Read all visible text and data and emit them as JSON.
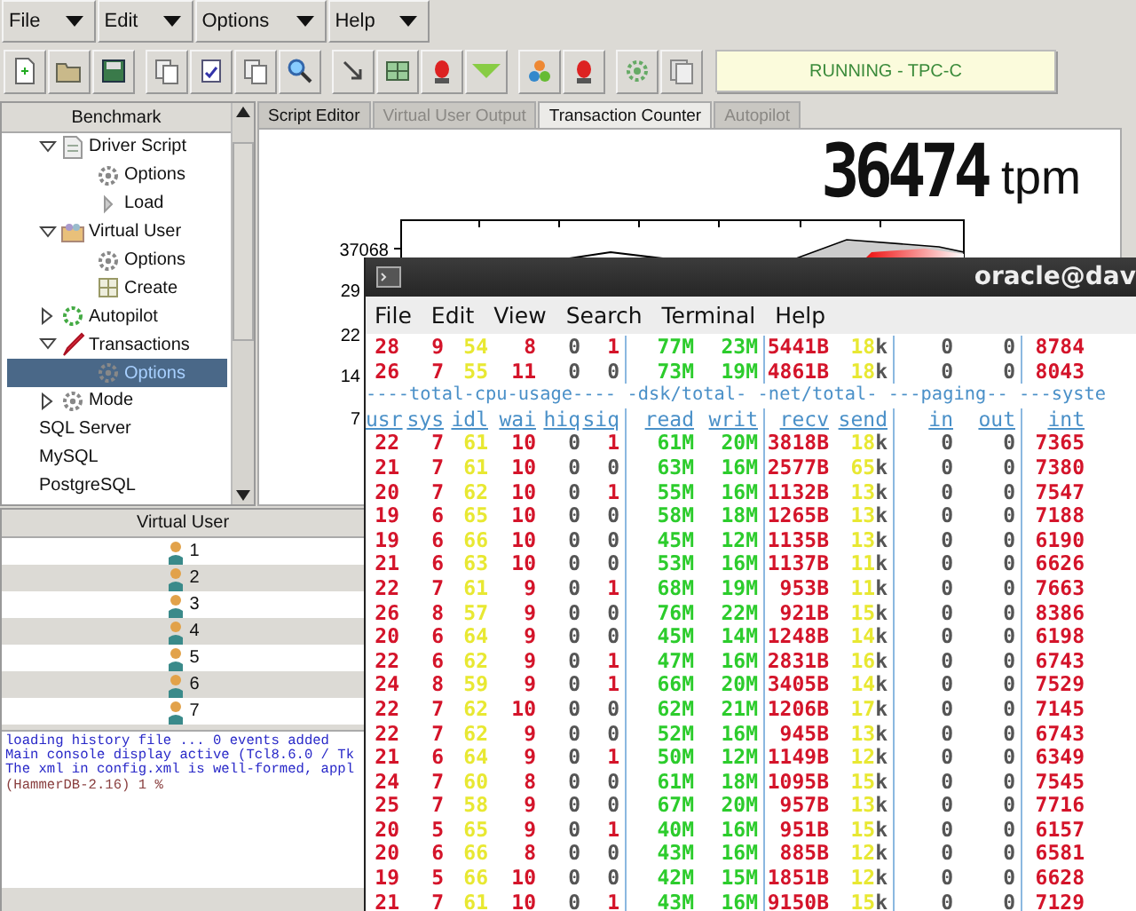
{
  "menus": [
    "File",
    "Edit",
    "Options",
    "Help"
  ],
  "status": "RUNNING - TPC-C",
  "tree": {
    "header": "Benchmark",
    "items": [
      {
        "children": [
          {
            "label": "Driver Script",
            "kind": "script",
            "expanded": true,
            "selected": false,
            "children": [
              {
                "label": "Options",
                "kind": "options",
                "selected": false
              },
              {
                "label": "Load",
                "kind": "load",
                "selected": false
              }
            ]
          },
          {
            "label": "Virtual User",
            "kind": "users",
            "expanded": true,
            "selected": false,
            "children": [
              {
                "label": "Options",
                "kind": "options",
                "selected": false
              },
              {
                "label": "Create",
                "kind": "create",
                "selected": false
              }
            ]
          },
          {
            "label": "Autopilot",
            "kind": "autopilot",
            "expanded": false,
            "selected": false
          },
          {
            "label": "Transactions",
            "kind": "transactions",
            "expanded": true,
            "selected": false,
            "children": [
              {
                "label": "Options",
                "kind": "options",
                "selected": true
              }
            ]
          },
          {
            "label": "Mode",
            "kind": "mode",
            "expanded": false,
            "selected": false
          }
        ]
      },
      {
        "label": "SQL Server",
        "selected": false
      },
      {
        "label": "MySQL",
        "selected": false
      },
      {
        "label": "PostgreSQL",
        "selected": false
      }
    ]
  },
  "tabs": [
    {
      "label": "Script Editor",
      "selected": false,
      "disabled": false
    },
    {
      "label": "Virtual User Output",
      "selected": false,
      "disabled": true
    },
    {
      "label": "Transaction Counter",
      "selected": true,
      "disabled": false
    },
    {
      "label": "Autopilot",
      "selected": false,
      "disabled": true
    }
  ],
  "transaction_counter": {
    "value": "36474",
    "unit": "tpm",
    "y_tick_labels": [
      "37068",
      "29",
      "22",
      "14",
      "7"
    ]
  },
  "virtual_users": {
    "header": "Virtual User",
    "rows": [
      "1",
      "2",
      "3",
      "4",
      "5",
      "6",
      "7"
    ]
  },
  "console": [
    {
      "kind": "output",
      "text": "loading history file ... 0 events added"
    },
    {
      "kind": "output",
      "text": "Main console display active (Tcl8.6.0 / Tk"
    },
    {
      "kind": "output",
      "text": "The xml in config.xml is well-formed, appl"
    },
    {
      "kind": "prompt",
      "text": "(HammerDB-2.16) 1 %"
    }
  ],
  "terminal": {
    "title": "oracle@dav",
    "menus": [
      "File",
      "Edit",
      "View",
      "Search",
      "Terminal",
      "Help"
    ],
    "lines": [
      {
        "kind": "data",
        "cells": [
          "28",
          "9",
          "54",
          "8",
          "0",
          "1",
          "77M",
          "23M",
          "5441B",
          "18k",
          "0",
          "0",
          "8784"
        ]
      },
      {
        "kind": "data",
        "cells": [
          "26",
          "7",
          "55",
          "11",
          "0",
          "0",
          "73M",
          "19M",
          "4861B",
          "18k",
          "0",
          "0",
          "8043"
        ]
      },
      {
        "kind": "group",
        "text": "----total-cpu-usage---- -dsk/total- -net/total- ---paging-- ---syste"
      },
      {
        "kind": "header",
        "cells": [
          "usr",
          "sys",
          "idl",
          "wai",
          "hiq",
          "siq",
          "read",
          "writ",
          "recv",
          "send",
          "in",
          "out",
          "int"
        ]
      },
      {
        "kind": "data",
        "cells": [
          "22",
          "7",
          "61",
          "10",
          "0",
          "1",
          "61M",
          "20M",
          "3818B",
          "18k",
          "0",
          "0",
          "7365"
        ]
      },
      {
        "kind": "data",
        "cells": [
          "21",
          "7",
          "61",
          "10",
          "0",
          "0",
          "63M",
          "16M",
          "2577B",
          "65k",
          "0",
          "0",
          "7380"
        ]
      },
      {
        "kind": "data",
        "cells": [
          "20",
          "7",
          "62",
          "10",
          "0",
          "1",
          "55M",
          "16M",
          "1132B",
          "13k",
          "0",
          "0",
          "7547"
        ]
      },
      {
        "kind": "data",
        "cells": [
          "19",
          "6",
          "65",
          "10",
          "0",
          "0",
          "58M",
          "18M",
          "1265B",
          "13k",
          "0",
          "0",
          "7188"
        ]
      },
      {
        "kind": "data",
        "cells": [
          "19",
          "6",
          "66",
          "10",
          "0",
          "0",
          "45M",
          "12M",
          "1135B",
          "13k",
          "0",
          "0",
          "6190"
        ]
      },
      {
        "kind": "data",
        "cells": [
          "21",
          "6",
          "63",
          "10",
          "0",
          "0",
          "53M",
          "16M",
          "1137B",
          "11k",
          "0",
          "0",
          "6626"
        ]
      },
      {
        "kind": "data",
        "cells": [
          "22",
          "7",
          "61",
          "9",
          "0",
          "1",
          "68M",
          "19M",
          "953B",
          "11k",
          "0",
          "0",
          "7663"
        ]
      },
      {
        "kind": "data",
        "cells": [
          "26",
          "8",
          "57",
          "9",
          "0",
          "0",
          "76M",
          "22M",
          "921B",
          "15k",
          "0",
          "0",
          "8386"
        ]
      },
      {
        "kind": "data",
        "cells": [
          "20",
          "6",
          "64",
          "9",
          "0",
          "0",
          "45M",
          "14M",
          "1248B",
          "14k",
          "0",
          "0",
          "6198"
        ]
      },
      {
        "kind": "data",
        "cells": [
          "22",
          "6",
          "62",
          "9",
          "0",
          "1",
          "47M",
          "16M",
          "2831B",
          "16k",
          "0",
          "0",
          "6743"
        ]
      },
      {
        "kind": "data",
        "cells": [
          "24",
          "8",
          "59",
          "9",
          "0",
          "1",
          "66M",
          "20M",
          "3405B",
          "14k",
          "0",
          "0",
          "7529"
        ]
      },
      {
        "kind": "data",
        "cells": [
          "22",
          "7",
          "62",
          "10",
          "0",
          "0",
          "62M",
          "21M",
          "1206B",
          "17k",
          "0",
          "0",
          "7145"
        ]
      },
      {
        "kind": "data",
        "cells": [
          "22",
          "7",
          "62",
          "9",
          "0",
          "0",
          "52M",
          "16M",
          "945B",
          "13k",
          "0",
          "0",
          "6743"
        ]
      },
      {
        "kind": "data",
        "cells": [
          "21",
          "6",
          "64",
          "9",
          "0",
          "1",
          "50M",
          "12M",
          "1149B",
          "12k",
          "0",
          "0",
          "6349"
        ]
      },
      {
        "kind": "data",
        "cells": [
          "24",
          "7",
          "60",
          "8",
          "0",
          "0",
          "61M",
          "18M",
          "1095B",
          "15k",
          "0",
          "0",
          "7545"
        ]
      },
      {
        "kind": "data",
        "cells": [
          "25",
          "7",
          "58",
          "9",
          "0",
          "0",
          "67M",
          "20M",
          "957B",
          "13k",
          "0",
          "0",
          "7716"
        ]
      },
      {
        "kind": "data",
        "cells": [
          "20",
          "5",
          "65",
          "9",
          "0",
          "1",
          "40M",
          "16M",
          "951B",
          "15k",
          "0",
          "0",
          "6157"
        ]
      },
      {
        "kind": "data",
        "cells": [
          "20",
          "6",
          "66",
          "8",
          "0",
          "0",
          "43M",
          "16M",
          "885B",
          "12k",
          "0",
          "0",
          "6581"
        ]
      },
      {
        "kind": "data",
        "cells": [
          "19",
          "5",
          "66",
          "10",
          "0",
          "0",
          "42M",
          "15M",
          "1851B",
          "12k",
          "0",
          "0",
          "6628"
        ]
      },
      {
        "kind": "data",
        "cells": [
          "21",
          "7",
          "61",
          "10",
          "0",
          "1",
          "43M",
          "16M",
          "9150B",
          "15k",
          "0",
          "0",
          "7129"
        ]
      }
    ]
  }
}
